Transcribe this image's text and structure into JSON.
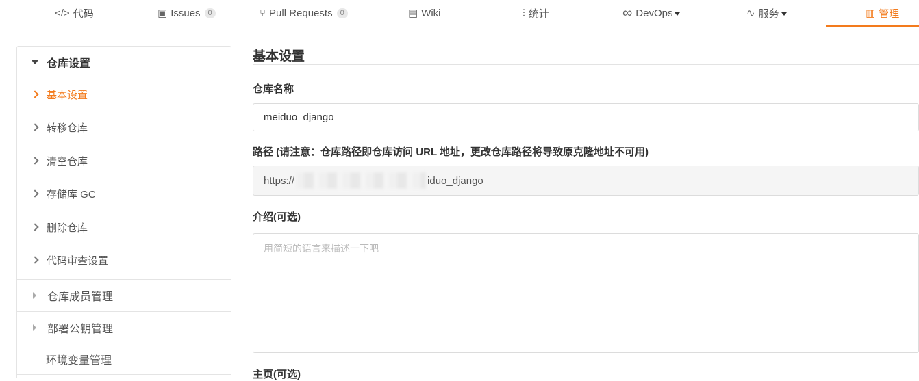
{
  "tabs": [
    {
      "icon": "</>",
      "label": "代码"
    },
    {
      "icon": "▣",
      "label": "Issues",
      "count": "0"
    },
    {
      "icon": "⑂",
      "label": "Pull Requests",
      "count": "0"
    },
    {
      "icon": "▤",
      "label": "Wiki"
    },
    {
      "icon": "⫶",
      "label": "统计"
    },
    {
      "icon": "∞",
      "label": "DevOps"
    },
    {
      "icon": "∿",
      "label": "服务"
    },
    {
      "icon": "▥",
      "label": "管理"
    }
  ],
  "sidebar": {
    "group_title": "仓库设置",
    "items": [
      {
        "label": "基本设置"
      },
      {
        "label": "转移仓库"
      },
      {
        "label": "清空仓库"
      },
      {
        "label": "存储库 GC"
      },
      {
        "label": "删除仓库"
      },
      {
        "label": "代码审查设置"
      }
    ],
    "sections": [
      {
        "label": "仓库成员管理"
      },
      {
        "label": "部署公钥管理"
      },
      {
        "label": "环境变量管理"
      }
    ]
  },
  "main": {
    "title": "基本设置",
    "repo_name_label": "仓库名称",
    "repo_name_value": "meiduo_django",
    "path_label": "路径 (请注意：仓库路径即仓库访问 URL 地址，更改仓库路径将导致原克隆地址不可用)",
    "path_prefix": "https://",
    "path_suffix": "iduo_django",
    "intro_label": "介绍(可选)",
    "intro_placeholder": "用简短的语言来描述一下吧",
    "homepage_label": "主页(可选)"
  },
  "colors": {
    "accent": "#f37b1d"
  }
}
